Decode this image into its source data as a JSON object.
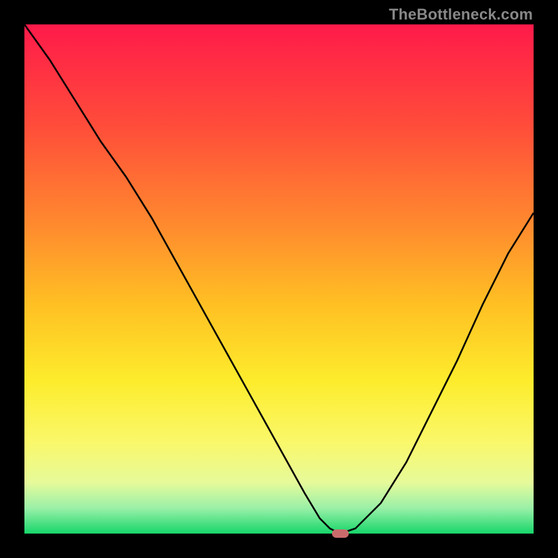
{
  "watermark": "TheBottleneck.com",
  "chart_data": {
    "type": "line",
    "title": "",
    "xlabel": "",
    "ylabel": "",
    "xlim": [
      0,
      100
    ],
    "ylim": [
      0,
      100
    ],
    "x": [
      0,
      5,
      10,
      15,
      20,
      25,
      30,
      35,
      40,
      45,
      50,
      55,
      58,
      60,
      62,
      65,
      70,
      75,
      80,
      85,
      90,
      95,
      100
    ],
    "values": [
      100,
      93,
      85,
      77,
      70,
      62,
      53,
      44,
      35,
      26,
      17,
      8,
      3,
      1,
      0,
      1,
      6,
      14,
      24,
      34,
      45,
      55,
      63
    ],
    "optimal_x": 62,
    "optimal_y": 0,
    "gradient_stops": [
      {
        "pos": 0,
        "color": "#ff1a4a"
      },
      {
        "pos": 20,
        "color": "#ff4d3a"
      },
      {
        "pos": 40,
        "color": "#ff8c2e"
      },
      {
        "pos": 55,
        "color": "#ffc023"
      },
      {
        "pos": 70,
        "color": "#fdec2c"
      },
      {
        "pos": 82,
        "color": "#faf86a"
      },
      {
        "pos": 90,
        "color": "#e6fa9a"
      },
      {
        "pos": 95,
        "color": "#9af0a8"
      },
      {
        "pos": 100,
        "color": "#16d66a"
      }
    ]
  }
}
